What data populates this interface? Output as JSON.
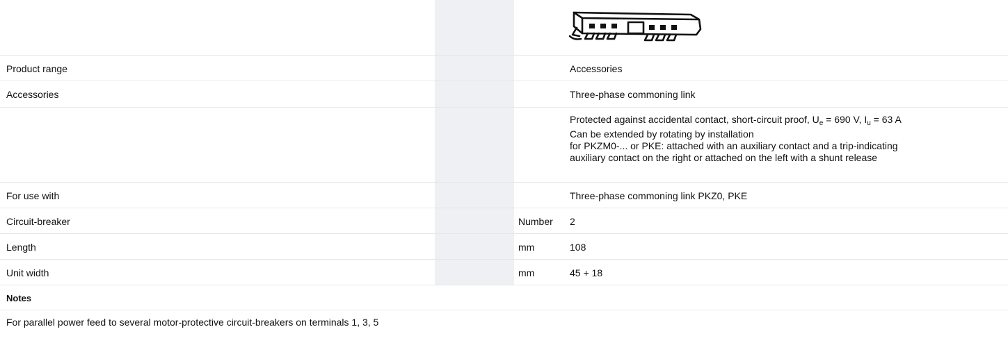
{
  "rows": {
    "product_range": {
      "label": "Product range",
      "value": "Accessories"
    },
    "accessories": {
      "label": "Accessories",
      "value": "Three-phase commoning link"
    },
    "description": {
      "line1_prefix": "Protected against accidental contact, short-circuit proof, U",
      "line1_sub1": "e",
      "line1_mid": " = 690 V, I",
      "line1_sub2": "u",
      "line1_suffix": " = 63 A",
      "line2": "Can be extended by rotating by installation",
      "line3": "for PKZM0-... or PKE: attached with an auxiliary contact and a trip-indicating",
      "line4": "auxiliary contact on the right or attached on the left with a shunt release"
    },
    "for_use_with": {
      "label": "For use with",
      "value": "Three-phase commoning link PKZ0, PKE"
    },
    "circuit_breaker": {
      "label": "Circuit-breaker",
      "unit": "Number",
      "value": "2"
    },
    "length": {
      "label": "Length",
      "unit": "mm",
      "value": "108"
    },
    "unit_width": {
      "label": "Unit width",
      "unit": "mm",
      "value": "45 + 18"
    }
  },
  "notes": {
    "heading": "Notes",
    "text": "For parallel power feed to several motor-protective circuit-breakers on terminals 1, 3, 5"
  },
  "product_image": {
    "icon": "commoning-link-drawing-icon"
  }
}
